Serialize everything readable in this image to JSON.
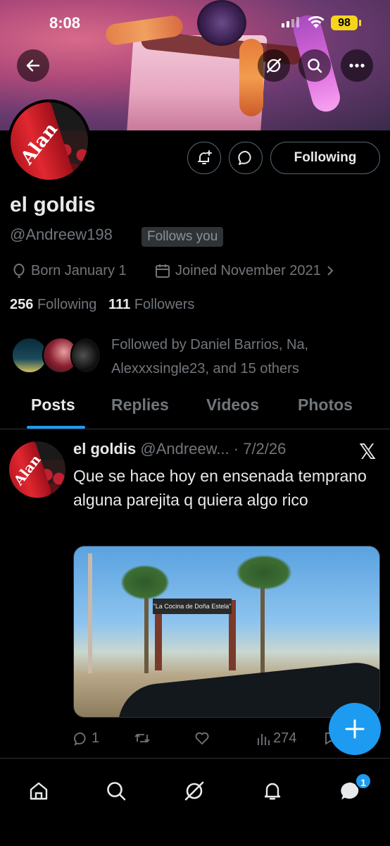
{
  "status_bar": {
    "time": "8:08",
    "battery": "98"
  },
  "profile": {
    "name": "el goldis",
    "handle": "@Andreew198",
    "follows_you": "Follows you",
    "born": "Born January 1",
    "joined": "Joined November 2021",
    "following_count": "256",
    "following_label": "Following",
    "followers_count": "111",
    "followers_label": "Followers",
    "followed_by": "Followed by Daniel Barrios, Na, Alexxxsingle23, and 15 others",
    "avatar_text": "Alan"
  },
  "actions": {
    "following_button": "Following"
  },
  "tabs": [
    {
      "label": "Posts",
      "active": true
    },
    {
      "label": "Replies",
      "active": false
    },
    {
      "label": "Videos",
      "active": false
    },
    {
      "label": "Photos",
      "active": false
    }
  ],
  "post": {
    "author": "el goldis",
    "handle_date": "@Andreew... · 7/2/26",
    "text": "Que se hace hoy en ensenada temprano  alguna parejita q quiera algo rico",
    "image_sign": "\"La Cocina de Doña Estela\"",
    "replies": "1",
    "views": "274"
  },
  "nav": {
    "messages_badge": "1"
  },
  "colors": {
    "accent": "#1d9bf0",
    "background": "#000000",
    "muted": "#71767b",
    "text": "#e7e9ea"
  }
}
